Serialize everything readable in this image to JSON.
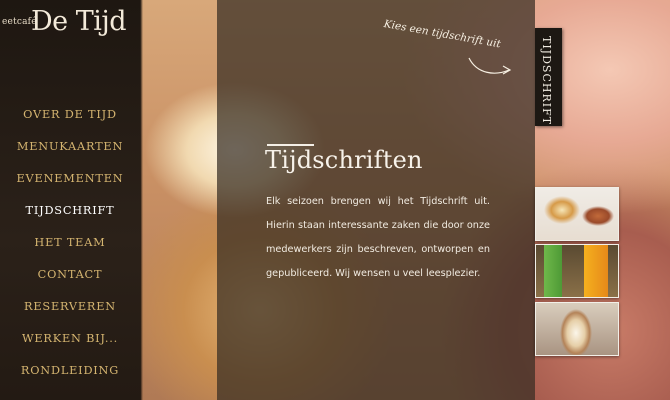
{
  "logo": {
    "small": "eetcafé",
    "big": "De Tijd"
  },
  "nav": {
    "items": [
      {
        "label": "OVER DE TIJD"
      },
      {
        "label": "MENUKAARTEN"
      },
      {
        "label": "EVENEMENTEN"
      },
      {
        "label": "TIJDSCHRIFT"
      },
      {
        "label": "HET TEAM"
      },
      {
        "label": "CONTACT"
      },
      {
        "label": "RESERVEREN"
      },
      {
        "label": "WERKEN BIJ..."
      },
      {
        "label": "RONDLEIDING"
      }
    ],
    "active_color": "#ffffff",
    "color": "#d4b470"
  },
  "content": {
    "heading": "Tijdschriften",
    "body": "Elk seizoen brengen wij het Tijdschrift uit. Hierin staan interessante zaken die door onze medewerkers zijn beschreven, ontworpen en gepubliceerd. Wij wensen u veel leesplezier."
  },
  "hint": "Kies een tijdschrift uit",
  "tab": {
    "label": "TIJDSCHRIFT"
  },
  "thumbnails": [
    {
      "name": "thumb-desserts"
    },
    {
      "name": "thumb-drinks"
    },
    {
      "name": "thumb-coffee"
    }
  ]
}
